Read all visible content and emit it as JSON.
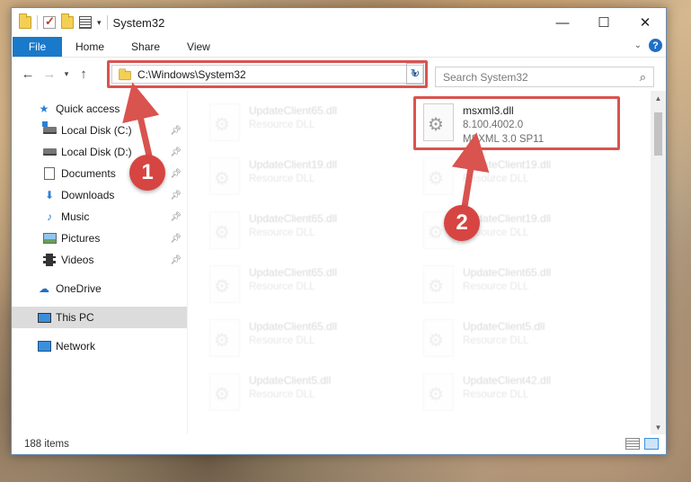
{
  "window": {
    "title": "System32",
    "minimize_icon": "—",
    "maximize_icon": "☐",
    "close_icon": "✕"
  },
  "ribbon": {
    "tabs": [
      "File",
      "Home",
      "Share",
      "View"
    ],
    "help_label": "?"
  },
  "navigation": {
    "back": "←",
    "forward": "→",
    "recent": "▾",
    "up": "↑",
    "address": "C:\\Windows\\System32",
    "refresh": "↻",
    "search_placeholder": "Search System32"
  },
  "sidebar": {
    "items": [
      {
        "label": "Quick access",
        "icon": "star-icon",
        "pinned": false
      },
      {
        "label": "Local Disk (C:)",
        "icon": "drive-c-icon",
        "pinned": true
      },
      {
        "label": "Local Disk (D:)",
        "icon": "drive-icon",
        "pinned": true
      },
      {
        "label": "Documents",
        "icon": "documents-icon",
        "pinned": true
      },
      {
        "label": "Downloads",
        "icon": "download-icon",
        "pinned": true
      },
      {
        "label": "Music",
        "icon": "music-icon",
        "pinned": true
      },
      {
        "label": "Pictures",
        "icon": "pictures-icon",
        "pinned": true
      },
      {
        "label": "Videos",
        "icon": "videos-icon",
        "pinned": true
      },
      {
        "label": "OneDrive",
        "icon": "onedrive-icon",
        "pinned": false
      },
      {
        "label": "This PC",
        "icon": "this-pc-icon",
        "pinned": false,
        "selected": true
      },
      {
        "label": "Network",
        "icon": "network-icon",
        "pinned": false
      }
    ]
  },
  "files": {
    "highlighted": {
      "name": "msxml3.dll",
      "version": "8.100.4002.0",
      "description": "MSXML 3.0 SP11"
    },
    "left_column": [
      {
        "name": "UpdateClient65.dll",
        "type": "Resource DLL"
      },
      {
        "name": "UpdateClient19.dll",
        "type": "Resource DLL"
      },
      {
        "name": "UpdateClient65.dll",
        "type": "Resource DLL"
      },
      {
        "name": "UpdateClient65.dll",
        "type": "Resource DLL"
      },
      {
        "name": "UpdateClient65.dll",
        "type": "Resource DLL"
      },
      {
        "name": "UpdateClient5.dll",
        "type": "Resource DLL"
      }
    ],
    "right_column": [
      {
        "name": "UpdateClient19.dll",
        "type": "Resource DLL"
      },
      {
        "name": "UpdateClient19.dll",
        "type": "Resource DLL"
      },
      {
        "name": "UpdateClient65.dll",
        "type": "Resource DLL"
      },
      {
        "name": "UpdateClient5.dll",
        "type": "Resource DLL"
      },
      {
        "name": "UpdateClient42.dll",
        "type": "Resource DLL"
      }
    ]
  },
  "status": {
    "item_count": "188 items"
  },
  "annotations": {
    "step1": "1",
    "step2": "2",
    "color": "#d9534f"
  }
}
